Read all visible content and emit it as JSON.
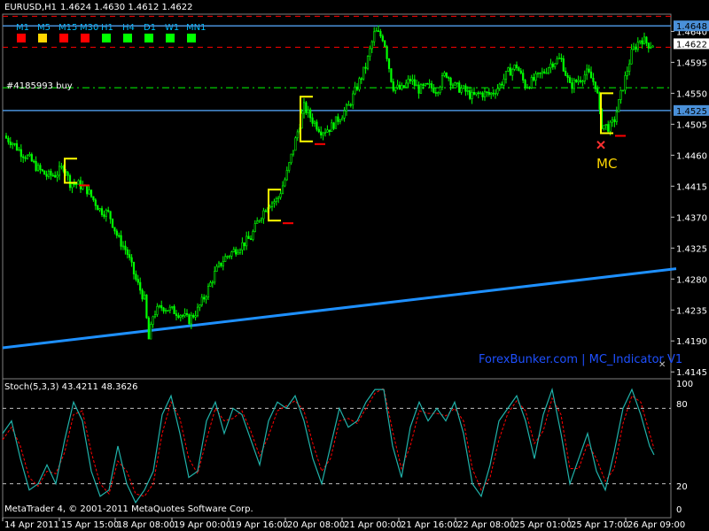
{
  "header": {
    "symbol": "EURUSD,H1",
    "ohlc": "1.4624 1.4630 1.4612 1.4622"
  },
  "timeframes": [
    {
      "label": "M1",
      "color": "#ff0000"
    },
    {
      "label": "M5",
      "color": "#ffd700"
    },
    {
      "label": "M15",
      "color": "#ff0000"
    },
    {
      "label": "M30",
      "color": "#ff0000"
    },
    {
      "label": "H1",
      "color": "#00ff00"
    },
    {
      "label": "H4",
      "color": "#00ff00"
    },
    {
      "label": "D1",
      "color": "#00ff00"
    },
    {
      "label": "W1",
      "color": "#00ff00"
    },
    {
      "label": "MN1",
      "color": "#00ff00"
    }
  ],
  "order_label": "#4185993 buy",
  "annotation": "MC",
  "watermark": "ForexBunker.com | MC_Indicator V1",
  "footer": "MetaTrader 4, © 2001-2011 MetaQuotes Software Corp.",
  "oscillator": {
    "title": "Stoch(5,3,3) 43.4211 48.3626",
    "levels": [
      "100",
      "80",
      "20",
      "0"
    ]
  },
  "price_axis": {
    "ticks": [
      "1.4640",
      "1.4595",
      "1.4550",
      "1.4505",
      "1.4460",
      "1.4415",
      "1.4370",
      "1.4325",
      "1.4280",
      "1.4235",
      "1.4190",
      "1.4145"
    ],
    "boxes": [
      "1.4648",
      "1.4622",
      "1.4525"
    ]
  },
  "time_axis": [
    "14 Apr 2011",
    "15 Apr 15:00",
    "18 Apr 08:00",
    "19 Apr 00:00",
    "19 Apr 16:00",
    "20 Apr 08:00",
    "21 Apr 00:00",
    "21 Apr 16:00",
    "22 Apr 08:00",
    "25 Apr 01:00",
    "25 Apr 17:00",
    "26 Apr 09:00"
  ],
  "colors": {
    "background": "#000000",
    "bull_candle": "#00ff00",
    "bear_candle": "#00ff00",
    "trendline": "#1e90ff",
    "hline": "#4a90d9",
    "resistance_dash": "#ff0000",
    "order_line": "#00ff00",
    "stoch_main": "#20b2aa",
    "stoch_signal": "#ff0000",
    "box_up": "#ffff00",
    "box_down": "#ff0000"
  },
  "chart_data": {
    "type": "line",
    "ylim": [
      1.4135,
      1.4665
    ],
    "price_close_path": [
      [
        0,
        1.4488
      ],
      [
        10,
        1.448
      ],
      [
        20,
        1.4465
      ],
      [
        30,
        1.4455
      ],
      [
        40,
        1.444
      ],
      [
        50,
        1.443
      ],
      [
        60,
        1.4432
      ],
      [
        70,
        1.4445
      ],
      [
        75,
        1.442
      ],
      [
        85,
        1.4418
      ],
      [
        95,
        1.441
      ],
      [
        110,
        1.438
      ],
      [
        120,
        1.4375
      ],
      [
        130,
        1.434
      ],
      [
        140,
        1.432
      ],
      [
        150,
        1.428
      ],
      [
        160,
        1.425
      ],
      [
        165,
        1.419
      ],
      [
        170,
        1.423
      ],
      [
        180,
        1.424
      ],
      [
        190,
        1.4235
      ],
      [
        200,
        1.423
      ],
      [
        210,
        1.422
      ],
      [
        220,
        1.4235
      ],
      [
        230,
        1.426
      ],
      [
        240,
        1.429
      ],
      [
        250,
        1.431
      ],
      [
        260,
        1.432
      ],
      [
        270,
        1.433
      ],
      [
        280,
        1.434
      ],
      [
        290,
        1.437
      ],
      [
        300,
        1.439
      ],
      [
        310,
        1.4395
      ],
      [
        320,
        1.443
      ],
      [
        330,
        1.448
      ],
      [
        340,
        1.453
      ],
      [
        350,
        1.451
      ],
      [
        360,
        1.4495
      ],
      [
        370,
        1.45
      ],
      [
        380,
        1.4515
      ],
      [
        390,
        1.453
      ],
      [
        400,
        1.456
      ],
      [
        410,
        1.459
      ],
      [
        420,
        1.464
      ],
      [
        430,
        1.463
      ],
      [
        440,
        1.456
      ],
      [
        450,
        1.4555
      ],
      [
        460,
        1.457
      ],
      [
        470,
        1.4555
      ],
      [
        480,
        1.456
      ],
      [
        490,
        1.4555
      ],
      [
        500,
        1.458
      ],
      [
        510,
        1.456
      ],
      [
        520,
        1.4555
      ],
      [
        530,
        1.4545
      ],
      [
        540,
        1.455
      ],
      [
        550,
        1.4548
      ],
      [
        560,
        1.456
      ],
      [
        570,
        1.458
      ],
      [
        580,
        1.459
      ],
      [
        590,
        1.456
      ],
      [
        600,
        1.457
      ],
      [
        610,
        1.458
      ],
      [
        620,
        1.4595
      ],
      [
        630,
        1.46
      ],
      [
        640,
        1.456
      ],
      [
        650,
        1.457
      ],
      [
        660,
        1.458
      ],
      [
        670,
        1.456
      ],
      [
        675,
        1.4505
      ],
      [
        685,
        1.45
      ],
      [
        690,
        1.451
      ],
      [
        700,
        1.456
      ],
      [
        710,
        1.461
      ],
      [
        720,
        1.463
      ],
      [
        730,
        1.462
      ],
      [
        735,
        1.4622
      ]
    ],
    "trendline": [
      [
        0,
        1.418
      ],
      [
        760,
        1.4295
      ]
    ],
    "hlines": [
      1.4648,
      1.4525
    ],
    "resistance_levels": [
      1.4662,
      1.4617
    ],
    "order_level": 1.4558,
    "markers": [
      {
        "x": 70,
        "hi": 1.4455,
        "lo": 1.442,
        "kind": "up"
      },
      {
        "x": 300,
        "hi": 1.441,
        "lo": 1.4365,
        "kind": "up"
      },
      {
        "x": 336,
        "hi": 1.4545,
        "lo": 1.448,
        "kind": "up"
      },
      {
        "x": 675,
        "hi": 1.455,
        "lo": 1.4492,
        "kind": "up"
      }
    ],
    "sell_x": {
      "x": 675,
      "y": 1.4475
    },
    "stoch_main": [
      [
        0,
        60
      ],
      [
        10,
        70
      ],
      [
        20,
        40
      ],
      [
        30,
        15
      ],
      [
        40,
        20
      ],
      [
        50,
        35
      ],
      [
        60,
        20
      ],
      [
        70,
        55
      ],
      [
        80,
        85
      ],
      [
        90,
        70
      ],
      [
        100,
        30
      ],
      [
        110,
        10
      ],
      [
        120,
        15
      ],
      [
        130,
        50
      ],
      [
        140,
        20
      ],
      [
        150,
        5
      ],
      [
        160,
        15
      ],
      [
        170,
        30
      ],
      [
        180,
        75
      ],
      [
        190,
        90
      ],
      [
        200,
        60
      ],
      [
        210,
        25
      ],
      [
        220,
        30
      ],
      [
        230,
        70
      ],
      [
        240,
        85
      ],
      [
        250,
        60
      ],
      [
        260,
        80
      ],
      [
        270,
        75
      ],
      [
        280,
        55
      ],
      [
        290,
        35
      ],
      [
        300,
        70
      ],
      [
        310,
        85
      ],
      [
        320,
        80
      ],
      [
        330,
        90
      ],
      [
        340,
        70
      ],
      [
        350,
        40
      ],
      [
        360,
        20
      ],
      [
        370,
        50
      ],
      [
        380,
        80
      ],
      [
        390,
        65
      ],
      [
        400,
        70
      ],
      [
        410,
        85
      ],
      [
        420,
        95
      ],
      [
        430,
        95
      ],
      [
        440,
        50
      ],
      [
        450,
        25
      ],
      [
        460,
        65
      ],
      [
        470,
        85
      ],
      [
        480,
        70
      ],
      [
        490,
        80
      ],
      [
        500,
        70
      ],
      [
        510,
        85
      ],
      [
        520,
        60
      ],
      [
        530,
        20
      ],
      [
        540,
        10
      ],
      [
        550,
        35
      ],
      [
        560,
        70
      ],
      [
        570,
        80
      ],
      [
        580,
        90
      ],
      [
        590,
        70
      ],
      [
        600,
        40
      ],
      [
        610,
        75
      ],
      [
        620,
        95
      ],
      [
        630,
        60
      ],
      [
        640,
        20
      ],
      [
        650,
        40
      ],
      [
        660,
        60
      ],
      [
        670,
        30
      ],
      [
        680,
        15
      ],
      [
        690,
        45
      ],
      [
        700,
        80
      ],
      [
        710,
        95
      ],
      [
        720,
        75
      ],
      [
        730,
        50
      ],
      [
        735,
        43
      ]
    ],
    "stoch_signal": [
      [
        0,
        55
      ],
      [
        10,
        65
      ],
      [
        20,
        50
      ],
      [
        30,
        25
      ],
      [
        40,
        18
      ],
      [
        50,
        30
      ],
      [
        60,
        28
      ],
      [
        70,
        45
      ],
      [
        80,
        75
      ],
      [
        90,
        78
      ],
      [
        100,
        45
      ],
      [
        110,
        20
      ],
      [
        120,
        12
      ],
      [
        130,
        38
      ],
      [
        140,
        30
      ],
      [
        150,
        12
      ],
      [
        160,
        10
      ],
      [
        170,
        20
      ],
      [
        180,
        60
      ],
      [
        190,
        85
      ],
      [
        200,
        72
      ],
      [
        210,
        40
      ],
      [
        220,
        28
      ],
      [
        230,
        55
      ],
      [
        240,
        80
      ],
      [
        250,
        70
      ],
      [
        260,
        72
      ],
      [
        270,
        78
      ],
      [
        280,
        62
      ],
      [
        290,
        42
      ],
      [
        300,
        58
      ],
      [
        310,
        78
      ],
      [
        320,
        82
      ],
      [
        330,
        86
      ],
      [
        340,
        78
      ],
      [
        350,
        52
      ],
      [
        360,
        30
      ],
      [
        370,
        40
      ],
      [
        380,
        70
      ],
      [
        390,
        72
      ],
      [
        400,
        68
      ],
      [
        410,
        80
      ],
      [
        420,
        92
      ],
      [
        430,
        96
      ],
      [
        440,
        62
      ],
      [
        450,
        32
      ],
      [
        460,
        50
      ],
      [
        470,
        78
      ],
      [
        480,
        76
      ],
      [
        490,
        76
      ],
      [
        500,
        74
      ],
      [
        510,
        80
      ],
      [
        520,
        70
      ],
      [
        530,
        32
      ],
      [
        540,
        15
      ],
      [
        550,
        25
      ],
      [
        560,
        55
      ],
      [
        570,
        76
      ],
      [
        580,
        86
      ],
      [
        590,
        78
      ],
      [
        600,
        52
      ],
      [
        610,
        62
      ],
      [
        620,
        88
      ],
      [
        630,
        75
      ],
      [
        640,
        32
      ],
      [
        650,
        32
      ],
      [
        660,
        52
      ],
      [
        670,
        40
      ],
      [
        680,
        22
      ],
      [
        690,
        32
      ],
      [
        700,
        68
      ],
      [
        710,
        90
      ],
      [
        720,
        85
      ],
      [
        730,
        60
      ],
      [
        735,
        48
      ]
    ]
  }
}
